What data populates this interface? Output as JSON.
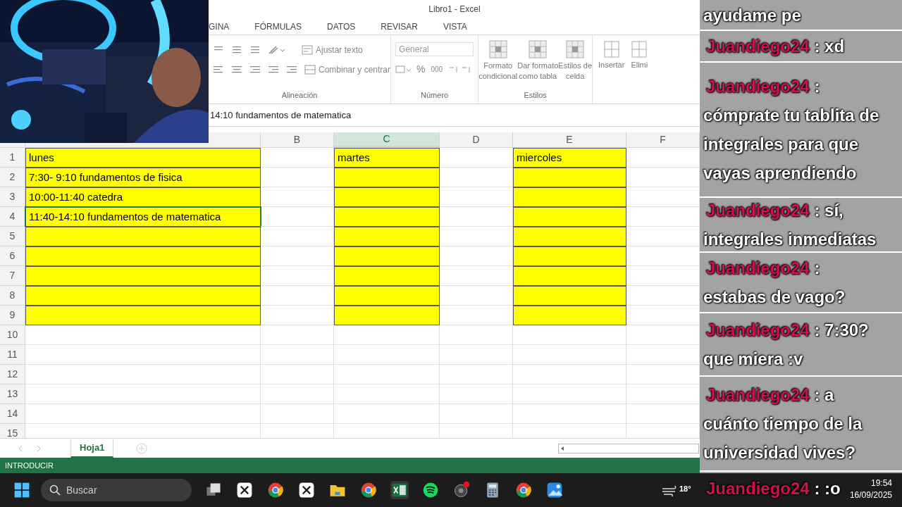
{
  "window": {
    "title": "Libro1 - Excel"
  },
  "ribbon_tabs": [
    {
      "label": "GINA",
      "selected": false
    },
    {
      "label": "FÓRMULAS",
      "selected": false
    },
    {
      "label": "DATOS",
      "selected": false
    },
    {
      "label": "REVISAR",
      "selected": false
    },
    {
      "label": "VISTA",
      "selected": false
    }
  ],
  "ribbon": {
    "wrap_text": "Ajustar texto",
    "merge_center": "Combinar y centrar",
    "number_format": "General",
    "percent": "%",
    "thousands": "000",
    "conditional_format": [
      "Formato",
      "condicional"
    ],
    "format_table": [
      "Dar formato",
      "como tabla"
    ],
    "cell_styles": [
      "Estilos de",
      "celda"
    ],
    "insert": "Insertar",
    "delete": "Elimi",
    "groups": [
      "Alineación",
      "Número",
      "Estilos"
    ]
  },
  "formula_bar": {
    "value": "14:10 fundamentos de matematica"
  },
  "columns": [
    {
      "label": "B",
      "selected": false
    },
    {
      "label": "C",
      "selected": true
    },
    {
      "label": "D",
      "selected": false
    },
    {
      "label": "E",
      "selected": false
    },
    {
      "label": "F",
      "selected": false
    }
  ],
  "rows": [
    {
      "number": "1",
      "cells": [
        {
          "text": "lunes",
          "highlighted": true,
          "selected": false
        },
        {
          "highlighted": false,
          "selected": false
        },
        {
          "text": "martes",
          "highlighted": true,
          "selected": false
        },
        {
          "highlighted": false,
          "selected": false
        },
        {
          "text": "miercoles",
          "highlighted": true,
          "selected": false
        },
        {
          "highlighted": false,
          "selected": false
        }
      ]
    },
    {
      "number": "2",
      "cells": [
        {
          "text": "7:30- 9:10 fundamentos de fisica",
          "highlighted": true,
          "selected": false
        },
        {
          "highlighted": false,
          "selected": false
        },
        {
          "highlighted": true,
          "selected": false
        },
        {
          "highlighted": false,
          "selected": false
        },
        {
          "highlighted": true,
          "selected": false
        },
        {
          "highlighted": false,
          "selected": false
        }
      ]
    },
    {
      "number": "3",
      "cells": [
        {
          "text": "10:00-11:40 catedra",
          "highlighted": true,
          "selected": false
        },
        {
          "highlighted": false,
          "selected": false
        },
        {
          "highlighted": true,
          "selected": false
        },
        {
          "highlighted": false,
          "selected": false
        },
        {
          "highlighted": true,
          "selected": false
        },
        {
          "highlighted": false,
          "selected": false
        }
      ]
    },
    {
      "number": "4",
      "cells": [
        {
          "text": "11:40-14:10 fundamentos de matematica",
          "highlighted": true,
          "selected": true
        },
        {
          "highlighted": false,
          "selected": false
        },
        {
          "highlighted": true,
          "selected": false
        },
        {
          "highlighted": false,
          "selected": false
        },
        {
          "highlighted": true,
          "selected": false
        },
        {
          "highlighted": false,
          "selected": false
        }
      ]
    },
    {
      "number": "5",
      "cells": [
        {
          "highlighted": true,
          "selected": false
        },
        {
          "highlighted": false,
          "selected": false
        },
        {
          "highlighted": true,
          "selected": false
        },
        {
          "highlighted": false,
          "selected": false
        },
        {
          "highlighted": true,
          "selected": false
        },
        {
          "highlighted": false,
          "selected": false
        }
      ]
    },
    {
      "number": "6",
      "cells": [
        {
          "highlighted": true,
          "selected": false
        },
        {
          "highlighted": false,
          "selected": false
        },
        {
          "highlighted": true,
          "selected": false
        },
        {
          "highlighted": false,
          "selected": false
        },
        {
          "highlighted": true,
          "selected": false
        },
        {
          "highlighted": false,
          "selected": false
        }
      ]
    },
    {
      "number": "7",
      "cells": [
        {
          "highlighted": true,
          "selected": false
        },
        {
          "highlighted": false,
          "selected": false
        },
        {
          "highlighted": true,
          "selected": false
        },
        {
          "highlighted": false,
          "selected": false
        },
        {
          "highlighted": true,
          "selected": false
        },
        {
          "highlighted": false,
          "selected": false
        }
      ]
    },
    {
      "number": "8",
      "cells": [
        {
          "highlighted": true,
          "selected": false
        },
        {
          "highlighted": false,
          "selected": false
        },
        {
          "highlighted": true,
          "selected": false
        },
        {
          "highlighted": false,
          "selected": false
        },
        {
          "highlighted": true,
          "selected": false
        },
        {
          "highlighted": false,
          "selected": false
        }
      ]
    },
    {
      "number": "9",
      "cells": [
        {
          "highlighted": true,
          "selected": false
        },
        {
          "highlighted": false,
          "selected": false
        },
        {
          "highlighted": true,
          "selected": false
        },
        {
          "highlighted": false,
          "selected": false
        },
        {
          "highlighted": true,
          "selected": false
        },
        {
          "highlighted": false,
          "selected": false
        }
      ]
    },
    {
      "number": "10"
    },
    {
      "number": "11"
    },
    {
      "number": "12"
    },
    {
      "number": "13"
    },
    {
      "number": "14"
    },
    {
      "number": "15"
    }
  ],
  "sheet_tabs": [
    {
      "label": "Hoja1",
      "selected": true
    }
  ],
  "status_bar": {
    "mode": "INTRODUCIR"
  },
  "taskbar": {
    "search_placeholder": "Buscar",
    "weather": "18°",
    "time": "19:54",
    "date": "16/09/2025"
  },
  "chat": [
    {
      "text": "ayudame pe"
    },
    {
      "user": "Juandiego24",
      "separator": ":",
      "text": "xd"
    },
    {
      "user": "Juandiego24",
      "separator": ":",
      "text": "cómprate tu tablita de integrales para que vayas aprendiendo"
    },
    {
      "user": "Juandiego24",
      "separator": ":",
      "text": "sí, integrales inmediatas"
    },
    {
      "user": "Juandiego24",
      "separator": ":",
      "text": "estabas de vago?"
    },
    {
      "user": "Juandiego24",
      "separator": ":",
      "text": "7:30? que miera :v"
    },
    {
      "user": "Juandiego24",
      "separator": ":",
      "text": "a cuánto tiempo de la universidad vives?"
    },
    {
      "user": "Juandiego24",
      "separator": ":",
      "text": ":o"
    }
  ]
}
